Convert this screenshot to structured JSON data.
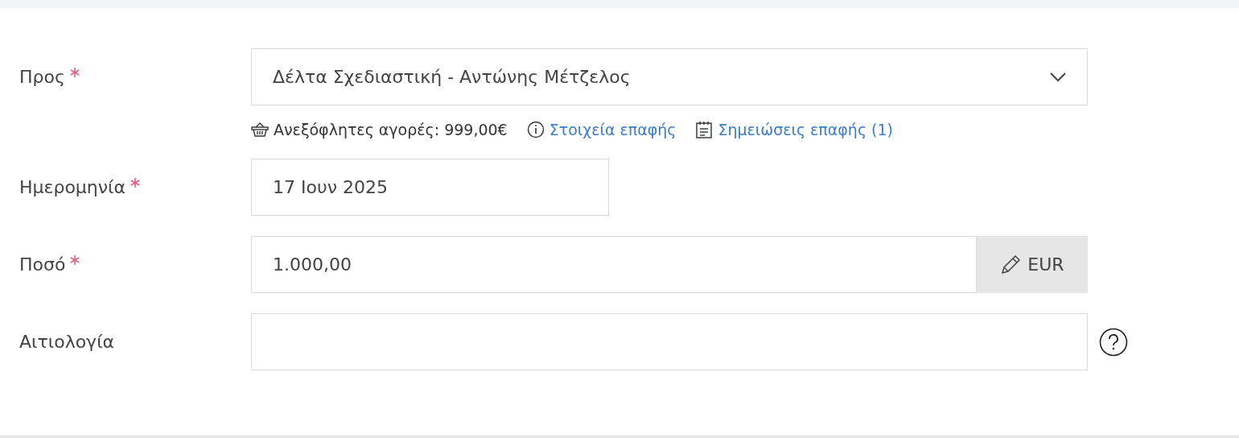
{
  "fields": [
    {
      "kind": "select",
      "label": "Προς",
      "required": true,
      "value": "Δέλτα Σχεδιαστική - Αντώνης Μέτζελος",
      "info": {
        "unpaid": "Ανεξόφλητες αγορές: 999,00€",
        "links": [
          {
            "kind": "info",
            "text": "Στοιχεία επαφής"
          },
          {
            "kind": "notes",
            "text": "Σημειώσεις επαφής (1)"
          }
        ]
      }
    },
    {
      "kind": "date",
      "label": "Ημερομηνία",
      "required": true,
      "value": "17 Ιουν 2025"
    },
    {
      "kind": "amount",
      "label": "Ποσό",
      "required": true,
      "value": "1.000,00",
      "currency": "EUR"
    },
    {
      "kind": "text",
      "label": "Αιτιολογία",
      "required": false,
      "help": true
    }
  ]
}
